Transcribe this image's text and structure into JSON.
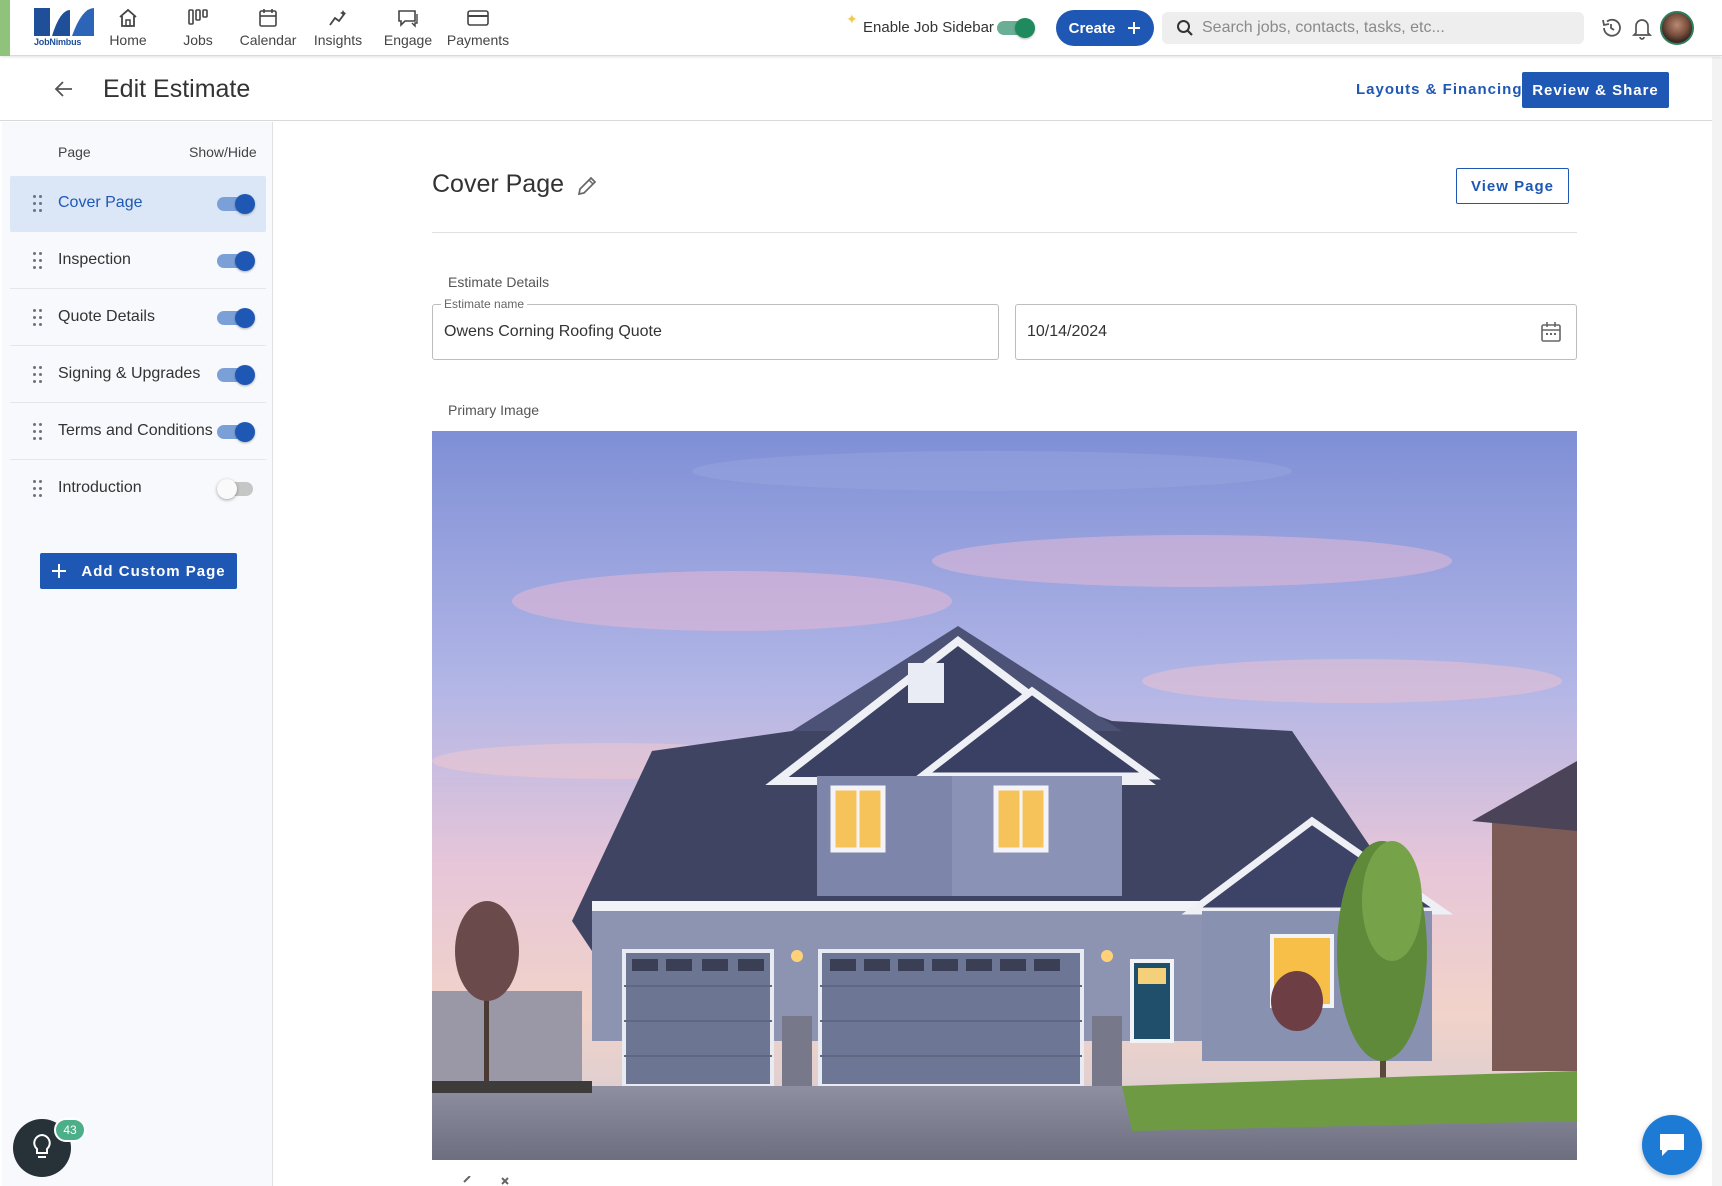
{
  "brand": {
    "name": "JobNimbus"
  },
  "nav": {
    "items": [
      {
        "label": "Home",
        "icon": "home-icon"
      },
      {
        "label": "Jobs",
        "icon": "jobs-icon"
      },
      {
        "label": "Calendar",
        "icon": "calendar-icon"
      },
      {
        "label": "Insights",
        "icon": "insights-icon"
      },
      {
        "label": "Engage",
        "icon": "engage-icon"
      },
      {
        "label": "Payments",
        "icon": "payments-icon"
      }
    ],
    "job_sidebar_label": "Enable Job Sidebar",
    "job_sidebar_enabled": true,
    "create_label": "Create",
    "search_placeholder": "Search jobs, contacts, tasks, etc..."
  },
  "header": {
    "title": "Edit Estimate",
    "layouts_label": "Layouts & Financing",
    "review_label": "Review & Share"
  },
  "pages_panel": {
    "col_page": "Page",
    "col_show": "Show/Hide",
    "pages": [
      {
        "label": "Cover Page",
        "shown": true,
        "active": true
      },
      {
        "label": "Inspection",
        "shown": true,
        "active": false
      },
      {
        "label": "Quote Details",
        "shown": true,
        "active": false
      },
      {
        "label": "Signing & Upgrades",
        "shown": true,
        "active": false
      },
      {
        "label": "Terms and Conditions",
        "shown": true,
        "active": false
      },
      {
        "label": "Introduction",
        "shown": false,
        "active": false
      }
    ],
    "add_page_label": "Add Custom Page"
  },
  "main": {
    "section_title": "Cover Page",
    "view_page_label": "View Page",
    "details_label": "Estimate Details",
    "estimate_name_legend": "Estimate name",
    "estimate_name": "Owens Corning Roofing Quote",
    "estimate_date": "10/14/2024",
    "primary_image_label": "Primary Image"
  },
  "help": {
    "count": "43"
  },
  "colors": {
    "primary": "#1f58b4",
    "toggle_green": "#1f8a5d",
    "active_row": "#dbe6f6",
    "chat": "#1d7bd6"
  }
}
